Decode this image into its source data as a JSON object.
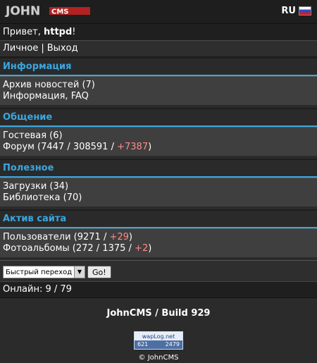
{
  "header": {
    "logo_text": "JOHN CMS",
    "lang": "RU"
  },
  "greeting": {
    "prefix": "Привет,",
    "user": "httpd",
    "suffix": "!"
  },
  "nav": {
    "personal": "Личное",
    "separator": "|",
    "logout": "Выход"
  },
  "sections": [
    {
      "title": "Информация",
      "items": [
        {
          "label": "Архив новостей (7)"
        },
        {
          "label": "Информация, FAQ"
        }
      ]
    },
    {
      "title": "Общение",
      "items": [
        {
          "label": "Гостевая (6)"
        },
        {
          "label": "Форум (7447 / 308591 / ",
          "new": "+7387",
          "end": ")"
        }
      ]
    },
    {
      "title": "Полезное",
      "items": [
        {
          "label": "Загрузки (34)"
        },
        {
          "label": "Библиотека (70)"
        }
      ]
    },
    {
      "title": "Актив сайта",
      "items": [
        {
          "label": "Пользователи (9271 / ",
          "new": "+29",
          "end": ")"
        },
        {
          "label": "Фотоальбомы (272 / 1375 / ",
          "new": "+2",
          "end": ")"
        }
      ]
    }
  ],
  "quick_jump": {
    "selected": "Быстрый переход",
    "go_label": "Go!"
  },
  "online": "Онлайн: 9 / 79",
  "footer": {
    "build": "JohnCMS / Build 929",
    "counter_title": "wapLog.net",
    "counter_left": "621",
    "counter_right": "2479",
    "copyright": "© JohnCMS"
  },
  "colors": {
    "accent": "#3aa7e0",
    "new_count": "#ff8a8a"
  }
}
